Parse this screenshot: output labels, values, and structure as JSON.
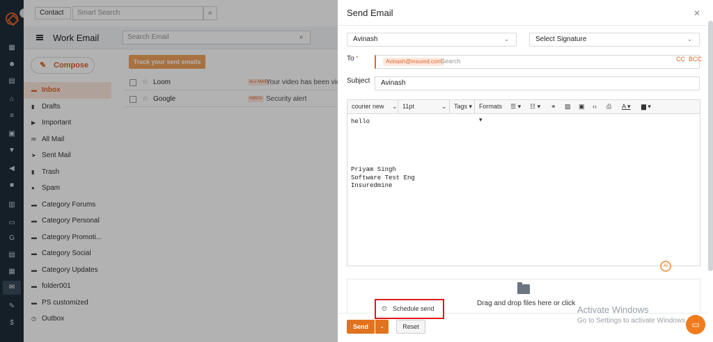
{
  "topbar": {
    "contact_select": "Contact",
    "smart_search_placeholder": "Smart Search"
  },
  "mail_app": {
    "folder_title": "Work Email",
    "search_placeholder": "Search Email",
    "compose_label": "Compose",
    "track_button": "Track your sent emails",
    "folders": [
      {
        "label": "Inbox",
        "active": true
      },
      {
        "label": "Drafts"
      },
      {
        "label": "Important"
      },
      {
        "label": "All Mail"
      },
      {
        "label": "Sent Mail"
      },
      {
        "label": "Trash"
      },
      {
        "label": "Spam"
      },
      {
        "label": "Category Forums"
      },
      {
        "label": "Category Personal"
      },
      {
        "label": "Category Promoti..."
      },
      {
        "label": "Category Social"
      },
      {
        "label": "Category Updates"
      },
      {
        "label": "folder001"
      },
      {
        "label": "PS customized"
      },
      {
        "label": "Outbox"
      }
    ],
    "emails": [
      {
        "sender": "Loom",
        "tag": "ALL MAIL",
        "subject": "Your video has been view"
      },
      {
        "sender": "Google",
        "tag": "INBOX",
        "subject": "Security alert"
      }
    ]
  },
  "modal": {
    "title": "Send Email",
    "from_select": "Avinash",
    "signature_select": "Select Signature",
    "to_label": "To",
    "to_required_mark": "*",
    "to_chip": "Avinash@insured.com",
    "to_search_placeholder": "Search",
    "cc_label": "CC",
    "bcc_label": "BCC",
    "subject_label": "Subject",
    "subject_value": "Avinash",
    "toolbar": {
      "font_family": "courier new",
      "font_size": "11pt",
      "tags": "Tags",
      "formats": "Formats"
    },
    "body_lines": [
      "hello",
      "",
      "",
      "",
      "",
      "",
      "Priyam Singh",
      "Software Test Eng",
      "Insuredmine"
    ],
    "ai_badge": "AI",
    "dropzone_text": "Drag and drop files here or click",
    "schedule_send": "Schedule send",
    "send_label": "Send",
    "reset_label": "Reset"
  },
  "watermark": {
    "line1": "Activate Windows",
    "line2": "Go to Settings to activate Windows."
  },
  "colors": {
    "accent": "#e0632a",
    "send_button": "#e0731f",
    "highlight_box": "#e0171b",
    "sidebar_dark": "#1f2d3a"
  }
}
